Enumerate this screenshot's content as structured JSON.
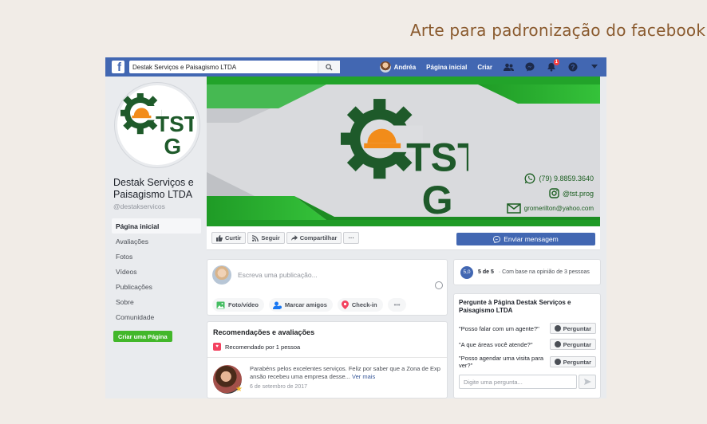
{
  "heading": "Arte para padronização do facebook",
  "topbar": {
    "search_value": "Destak Serviços e Paisagismo LTDA",
    "user_name": "Andréa",
    "home_label": "Página inicial",
    "create_label": "Criar",
    "notifications_count": "1",
    "brand_color": "#4267b2"
  },
  "logo": {
    "text_line1": "TST",
    "text_line2": "G",
    "gear_color": "#1e5a2a",
    "helmet_color": "#f28c1a"
  },
  "page": {
    "name": "Destak Serviços e Paisagismo LTDA",
    "handle": "@destakservicos"
  },
  "nav": {
    "items": [
      "Página inicial",
      "Avaliações",
      "Fotos",
      "Vídeos",
      "Publicações",
      "Sobre",
      "Comunidade"
    ],
    "create_page": "Criar uma Página"
  },
  "cover": {
    "phone": "(79) 9.8859.3640",
    "instagram": "@tst.prog",
    "email": "gromerilton@yahoo.com",
    "accent": "#22a32a"
  },
  "actions": {
    "like": "Curtir",
    "follow": "Seguir",
    "share": "Compartilhar",
    "more": "···",
    "send_message": "Enviar mensagem"
  },
  "composer": {
    "placeholder": "Escreva uma publicação...",
    "photo_video": "Foto/vídeo",
    "tag_friends": "Marcar amigos",
    "checkin": "Check-in",
    "more": "•••"
  },
  "reviews": {
    "title": "Recomendações e avaliações",
    "recommended": "Recomendado por 1 pessoa",
    "text": "Parabéns pelos excelentes serviços. Feliz por saber que a Zona de Exp ansão recebeu uma empresa desse...",
    "see_more": "Ver mais",
    "date": "6 de setembro de 2017"
  },
  "rating": {
    "score": "5,0",
    "label": "5 de 5",
    "based_on": "· Com base na opinião de 3 pessoas"
  },
  "ask": {
    "title": "Pergunte à Página Destak Serviços e Paisagismo LTDA",
    "questions": [
      "\"Posso falar com um agente?\"",
      "\"A que áreas você atende?\"",
      "\"Posso agendar uma visita para ver?\""
    ],
    "button_label": "Perguntar",
    "input_placeholder": "Digite uma pergunta..."
  }
}
